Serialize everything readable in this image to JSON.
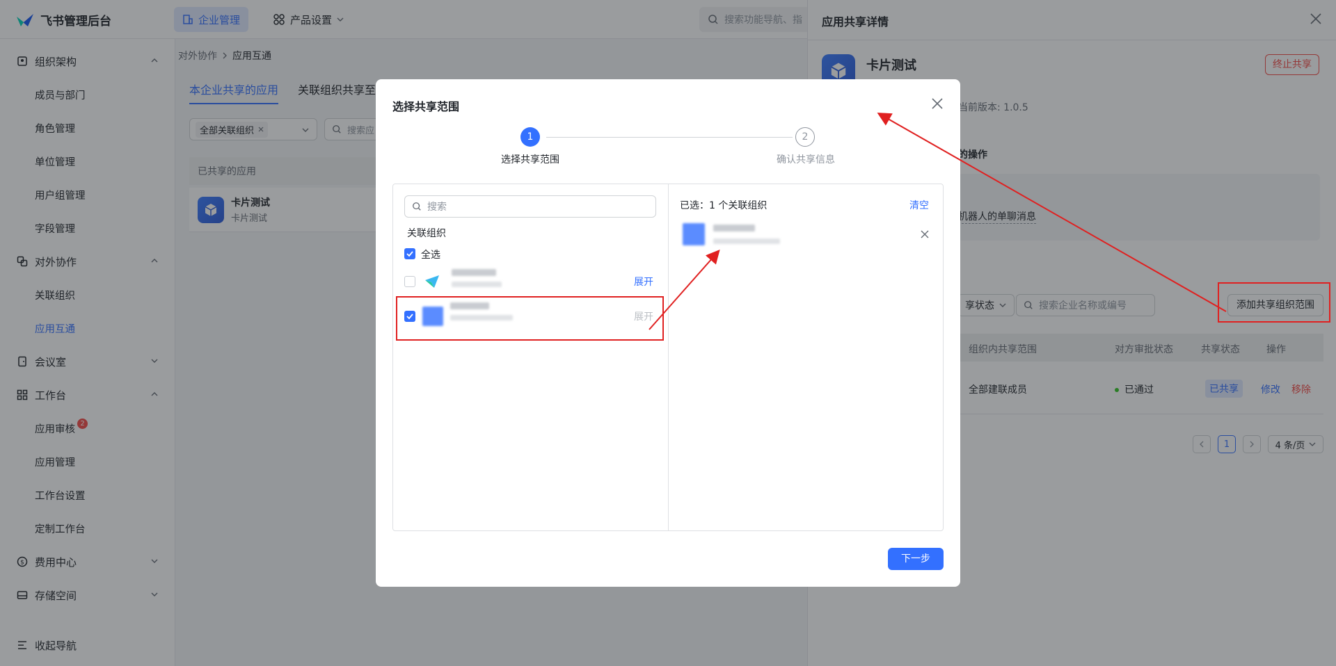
{
  "topbar": {
    "logo_text": "飞书管理后台",
    "nav_tabs": [
      {
        "label": "企业管理",
        "icon": "building-icon"
      },
      {
        "label": "产品设置",
        "icon": "grid-settings-icon"
      }
    ],
    "search_placeholder": "搜索功能导航、指"
  },
  "sidebar": {
    "groups": [
      {
        "label": "组织架构",
        "icon": "org-icon",
        "expanded": true,
        "items": [
          "成员与部门",
          "角色管理",
          "单位管理",
          "用户组管理",
          "字段管理"
        ]
      },
      {
        "label": "对外协作",
        "icon": "external-collab-icon",
        "expanded": true,
        "items": [
          "关联组织",
          "应用互通"
        ]
      },
      {
        "label": "会议室",
        "icon": "meeting-room-icon",
        "expanded": false,
        "items": []
      },
      {
        "label": "工作台",
        "icon": "workbench-icon",
        "expanded": true,
        "items": [
          "应用审核",
          "应用管理",
          "工作台设置",
          "定制工作台"
        ]
      },
      {
        "label": "费用中心",
        "icon": "cost-icon",
        "expanded": false,
        "items": []
      },
      {
        "label": "存储空间",
        "icon": "storage-icon",
        "expanded": false,
        "items": []
      }
    ],
    "active_item": "应用互通",
    "review_badge": "2",
    "collapse_label": "收起导航"
  },
  "main": {
    "breadcrumb": [
      "对外协作",
      "应用互通"
    ],
    "tabs": [
      "本企业共享的应用",
      "关联组织共享至"
    ],
    "filter_tag": "全部关联组织",
    "filter_search_placeholder": "搜索应",
    "table_header": "已共享的应用",
    "app_name": "卡片测试",
    "app_desc": "卡片测试"
  },
  "drawer": {
    "title": "应用共享详情",
    "app_name": "卡片测试",
    "stop_share": "终止共享",
    "version": "当前版本: 1.0.5",
    "ops_title": "的操作",
    "ops_link": "机器人的单聊消息",
    "share_state_select": "享状态",
    "org_search_placeholder": "搜索企业名称或编号",
    "add_scope_button": "添加共享组织范围",
    "table_headers": [
      "组织内共享范围",
      "对方审批状态",
      "共享状态",
      "操作"
    ],
    "row": {
      "scope": "全部建联成员",
      "approval": "已通过",
      "share_state": "已共享",
      "edit": "修改",
      "remove": "移除"
    },
    "pager": {
      "current": "1",
      "page_size": "4 条/页"
    }
  },
  "modal": {
    "title": "选择共享范围",
    "steps": [
      {
        "num": "1",
        "label": "选择共享范围"
      },
      {
        "num": "2",
        "label": "确认共享信息"
      }
    ],
    "search_placeholder": "搜索",
    "section_label": "关联组织",
    "select_all": "全选",
    "expand_label": "展开",
    "selected_count": "已选：1 个关联组织",
    "clear_label": "清空",
    "next_button": "下一步"
  },
  "colors": {
    "accent": "#3370ff",
    "annotation": "#e02020",
    "danger": "#f54a45"
  }
}
